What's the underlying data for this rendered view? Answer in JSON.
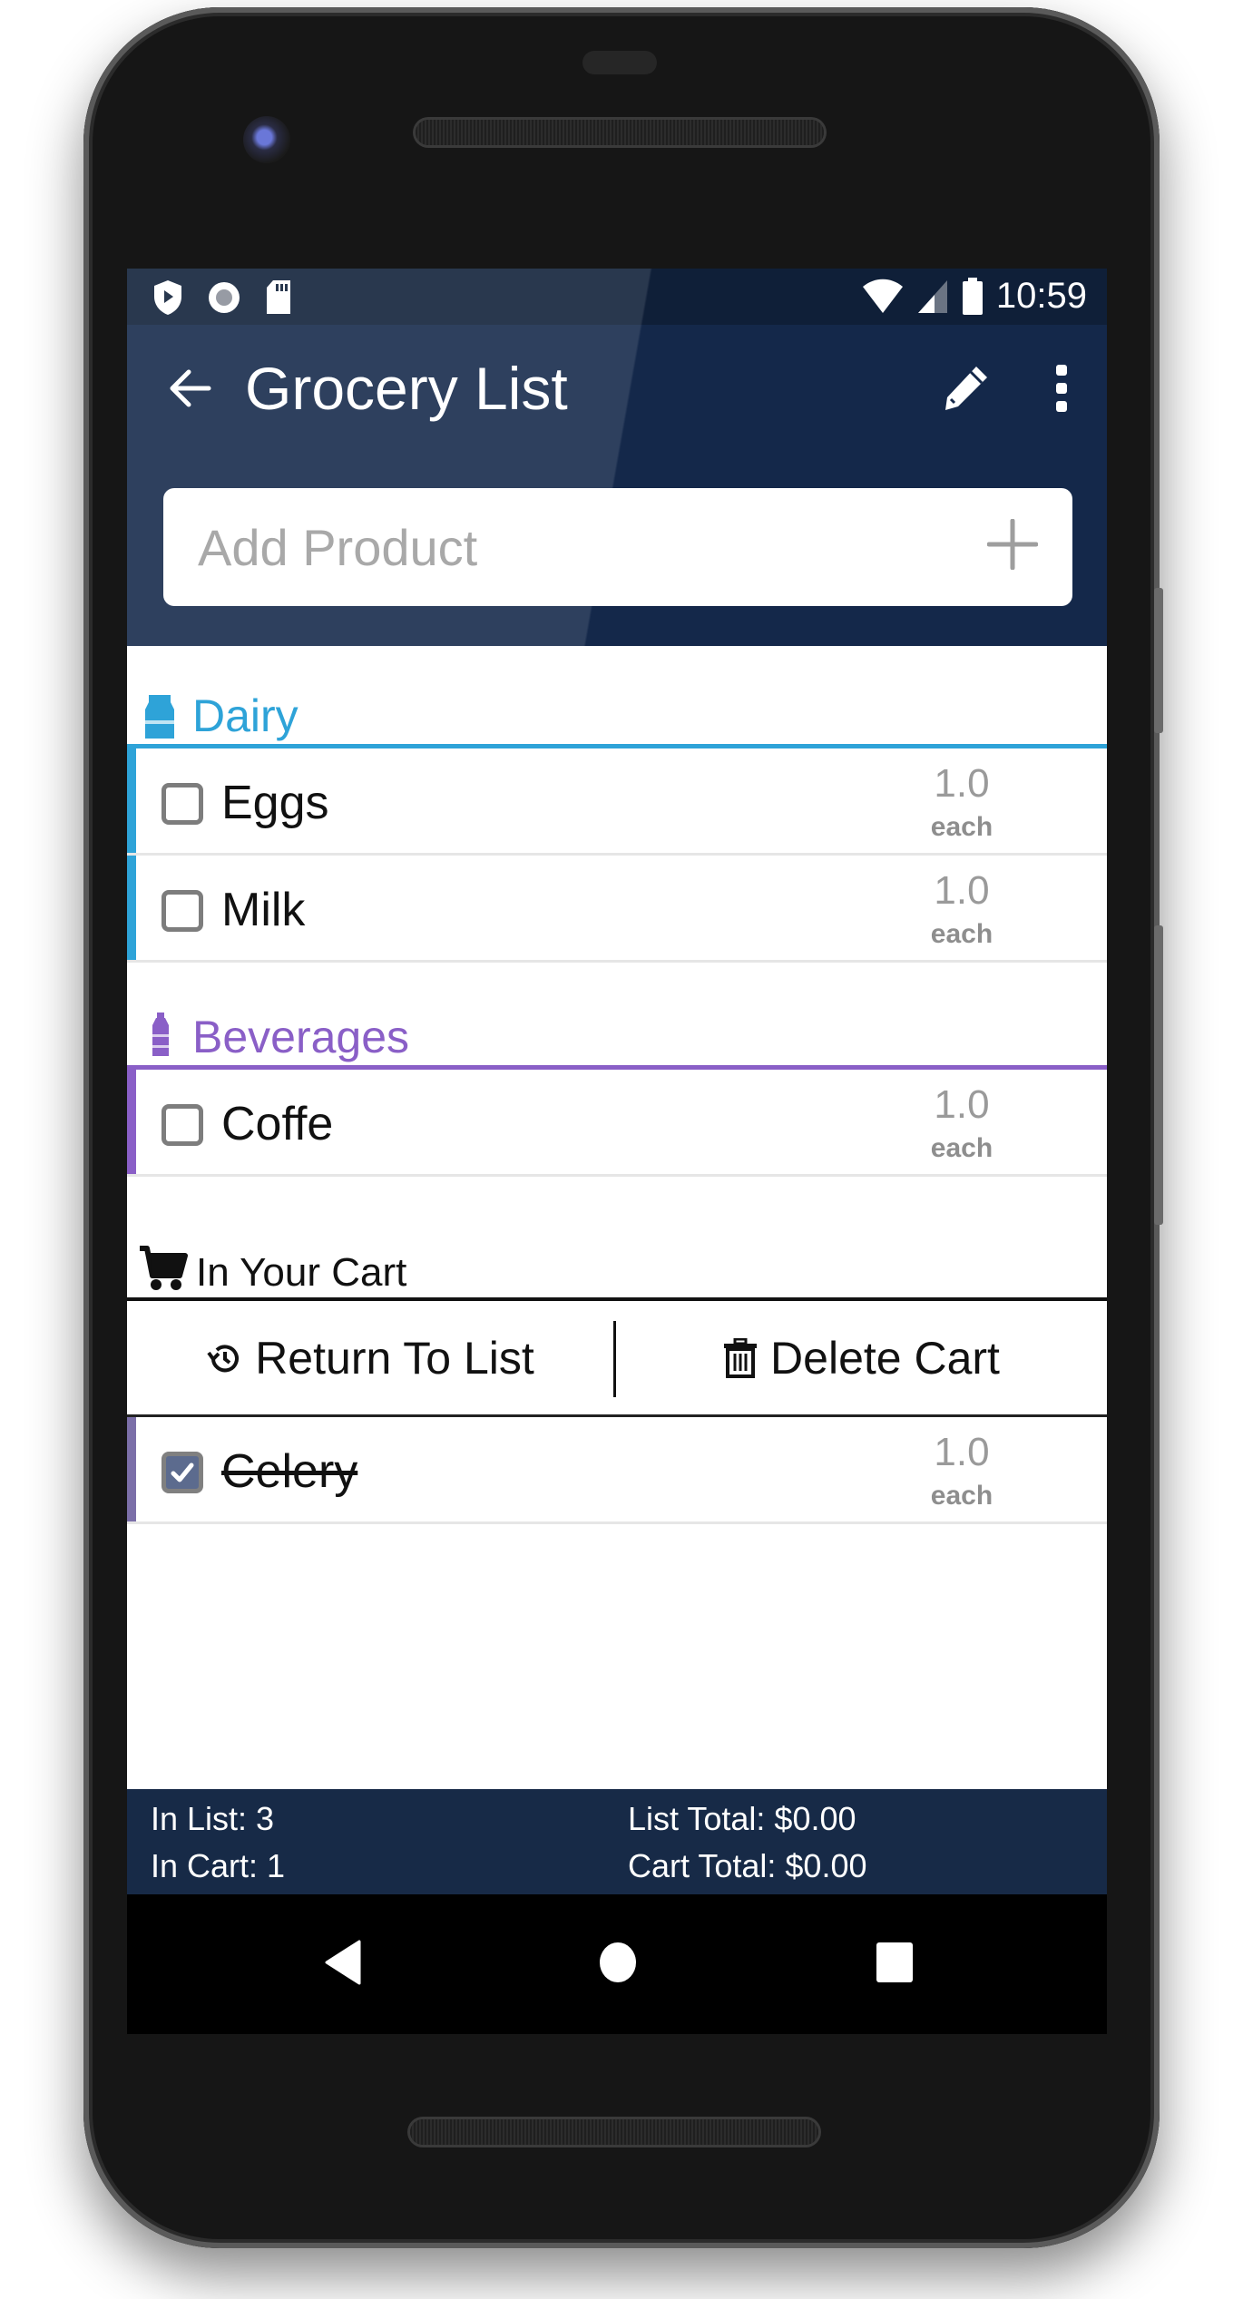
{
  "status_bar": {
    "time": "10:59",
    "left_icons": [
      "shield-play-icon",
      "record-icon",
      "sd-card-icon"
    ],
    "right_icons": [
      "wifi-icon",
      "cell-signal-icon",
      "battery-icon"
    ]
  },
  "app_bar": {
    "title": "Grocery List",
    "back_icon": "arrow-left-icon",
    "edit_icon": "pencil-icon",
    "more_icon": "more-vert-icon"
  },
  "add_product": {
    "placeholder": "Add Product",
    "value": "",
    "add_icon": "plus-icon"
  },
  "categories": [
    {
      "name": "Dairy",
      "color": "#2ea3d8",
      "icon": "milk-carton-icon",
      "items": [
        {
          "name": "Eggs",
          "qty": "1.0",
          "unit": "each",
          "checked": false
        },
        {
          "name": "Milk",
          "qty": "1.0",
          "unit": "each",
          "checked": false
        }
      ]
    },
    {
      "name": "Beverages",
      "color": "#8a5fc7",
      "icon": "bottle-icon",
      "items": [
        {
          "name": "Coffe",
          "qty": "1.0",
          "unit": "each",
          "checked": false
        }
      ]
    }
  ],
  "cart": {
    "header": "In Your Cart",
    "return_label": "Return To List",
    "delete_label": "Delete Cart",
    "items": [
      {
        "name": "Celery",
        "qty": "1.0",
        "unit": "each",
        "checked": true,
        "color": "#7b6fa8"
      }
    ]
  },
  "footer": {
    "in_list": "In List: 3",
    "in_cart": "In Cart: 1",
    "list_total": "List Total: $0.00",
    "cart_total": "Cart Total: $0.00"
  },
  "nav": {
    "back": "nav-back-icon",
    "home": "nav-home-icon",
    "recents": "nav-recents-icon"
  }
}
